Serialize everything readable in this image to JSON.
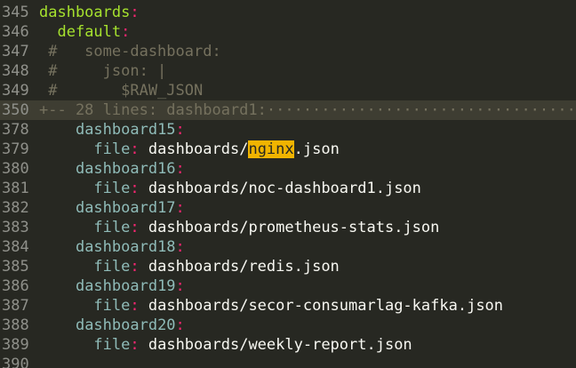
{
  "editor": {
    "highlight_color": "#f0b400",
    "background_color": "#272822",
    "lines": [
      {
        "num": "345",
        "indent": "",
        "key": "dashboards",
        "key_color": "green",
        "colon": ":",
        "value": ""
      },
      {
        "num": "346",
        "indent": "  ",
        "key": "default",
        "key_color": "green",
        "colon": ":",
        "value": ""
      },
      {
        "num": "347",
        "comment": " #   some-dashboard:"
      },
      {
        "num": "348",
        "comment": " #     json: |"
      },
      {
        "num": "349",
        "comment": " #       $RAW_JSON"
      },
      {
        "num": "350",
        "fold": "+-- 28 lines: dashboard1:",
        "dots": "···················································"
      },
      {
        "num": "378",
        "indent": "    ",
        "key": "dashboard15",
        "key_color": "teal",
        "colon": ":",
        "value": ""
      },
      {
        "num": "379",
        "indent": "      ",
        "key": "file",
        "key_color": "teal",
        "colon": ":",
        "value_pre": " dashboards/",
        "match": "nginx",
        "value_post": ".json"
      },
      {
        "num": "380",
        "indent": "    ",
        "key": "dashboard16",
        "key_color": "teal",
        "colon": ":",
        "value": ""
      },
      {
        "num": "381",
        "indent": "      ",
        "key": "file",
        "key_color": "teal",
        "colon": ":",
        "value": " dashboards/noc-dashboard1.json"
      },
      {
        "num": "382",
        "indent": "    ",
        "key": "dashboard17",
        "key_color": "teal",
        "colon": ":",
        "value": ""
      },
      {
        "num": "383",
        "indent": "      ",
        "key": "file",
        "key_color": "teal",
        "colon": ":",
        "value": " dashboards/prometheus-stats.json"
      },
      {
        "num": "384",
        "indent": "    ",
        "key": "dashboard18",
        "key_color": "teal",
        "colon": ":",
        "value": ""
      },
      {
        "num": "385",
        "indent": "      ",
        "key": "file",
        "key_color": "teal",
        "colon": ":",
        "value": " dashboards/redis.json"
      },
      {
        "num": "386",
        "indent": "    ",
        "key": "dashboard19",
        "key_color": "teal",
        "colon": ":",
        "value": ""
      },
      {
        "num": "387",
        "indent": "      ",
        "key": "file",
        "key_color": "teal",
        "colon": ":",
        "value": " dashboards/secor-consumarlag-kafka.json"
      },
      {
        "num": "388",
        "indent": "    ",
        "key": "dashboard20",
        "key_color": "teal",
        "colon": ":",
        "value": ""
      },
      {
        "num": "389",
        "indent": "      ",
        "key": "file",
        "key_color": "teal",
        "colon": ":",
        "value": " dashboards/weekly-report.json"
      },
      {
        "num": "390",
        "indent": "",
        "key": "",
        "key_color": "teal",
        "colon": "",
        "value": ""
      }
    ]
  }
}
